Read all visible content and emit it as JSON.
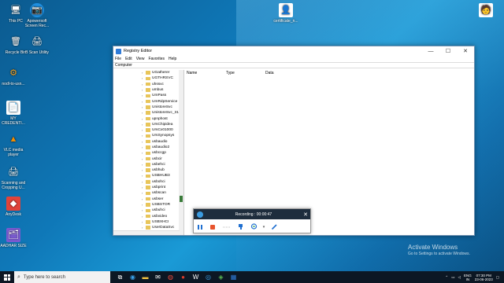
{
  "desktop": {
    "icons": [
      {
        "label": "This PC",
        "glyph": "🖥"
      },
      {
        "label": "Apowersoft Screen Rec...",
        "glyph": "📷"
      },
      {
        "label": "Recycle Bin",
        "glyph": "🗑"
      },
      {
        "label": "B Scan Utility",
        "glyph": "🖨"
      },
      {
        "label": "nodl-to-usn...",
        "glyph": "⚙"
      },
      {
        "label": "MY CREDENTI...",
        "glyph": "📄"
      },
      {
        "label": "VLC media player",
        "glyph": "▲"
      },
      {
        "label": "Scanning and Cropping U...",
        "glyph": "🖨"
      },
      {
        "label": "AnyDesk",
        "glyph": "◆"
      },
      {
        "label": "AADHAR SIZE",
        "glyph": "🗂"
      },
      {
        "label": "certificate_n...",
        "glyph": "👤"
      },
      {
        "label": "",
        "glyph": "🧑"
      }
    ]
  },
  "registry": {
    "title": "Registry Editor",
    "controls": {
      "minimize": "—",
      "maximize": "☐",
      "close": "✕"
    },
    "menu": [
      "File",
      "Edit",
      "View",
      "Favorites",
      "Help"
    ],
    "address": "Computer",
    "tree_items": [
      "UGatherer",
      "UGTHRSVC",
      "uhssvc",
      "umbus",
      "UmPass",
      "UmRdpService",
      "UnistoreSvc",
      "UnistoreSvc_31",
      "upnphost",
      "UrsChipidea",
      "UrsCx01000",
      "UrsSynopsys",
      "usbaudio",
      "usbaudio2",
      "usbccgp",
      "usbcir",
      "usbehci",
      "usbhub",
      "USBHUB3",
      "usbohci",
      "usbprint",
      "usbscan",
      "usbser",
      "USBSTOR",
      "usbuhci",
      "usbvideo",
      "USBXHCI",
      "UserDataSvc"
    ],
    "columns": [
      "Name",
      "Type",
      "Data"
    ]
  },
  "recorder": {
    "status": "Recording : 00:00:47",
    "close": "✕"
  },
  "watermark": {
    "line1": "Activate Windows",
    "line2": "Go to Settings to activate Windows."
  },
  "taskbar": {
    "search_placeholder": "Type here to search",
    "lang": "ENG",
    "region": "IN",
    "time": "07:30 PM",
    "date": "23-06-2023"
  },
  "colors": {
    "taskbar": "#0c1724",
    "folder": "#e8c55a",
    "recorder_header": "#1e2d3d"
  }
}
